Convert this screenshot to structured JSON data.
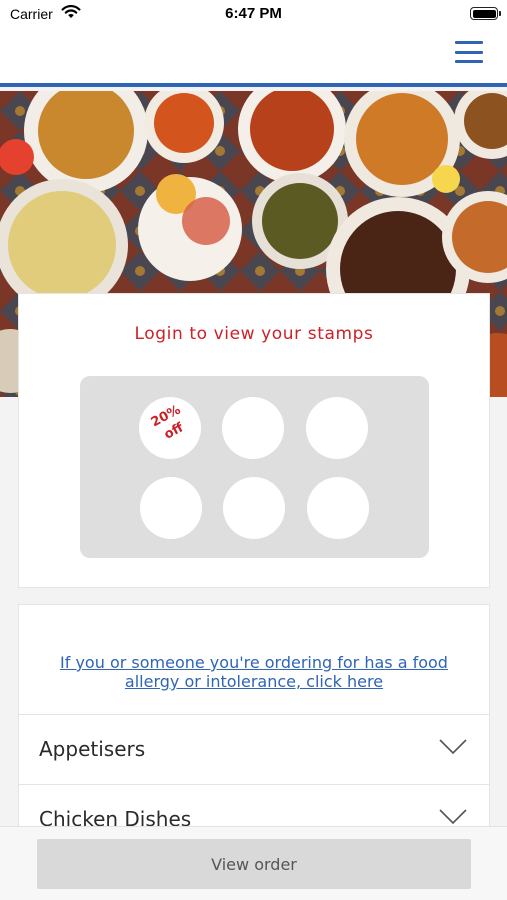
{
  "status_bar": {
    "carrier": "Carrier",
    "time": "6:47 PM",
    "wifi_icon": "wifi-icon",
    "battery_icon": "battery-icon"
  },
  "header": {
    "menu_icon": "hamburger-menu-icon",
    "accent_color": "#2f64b7"
  },
  "hero": {
    "image": "restaurant food spread photo"
  },
  "stamps": {
    "title": "Login to view your stamps",
    "reward_line1": "20%",
    "reward_line2": "off",
    "title_color": "#cc2127"
  },
  "allergy": {
    "link_text": "If you or someone you're ordering for has a food allergy or intolerance, click here"
  },
  "menu": {
    "categories": [
      {
        "label": "Appetisers",
        "icon": "chevron-down-icon"
      },
      {
        "label": "Chicken Dishes",
        "icon": "chevron-down-icon"
      }
    ]
  },
  "order": {
    "button_label": "View order"
  }
}
